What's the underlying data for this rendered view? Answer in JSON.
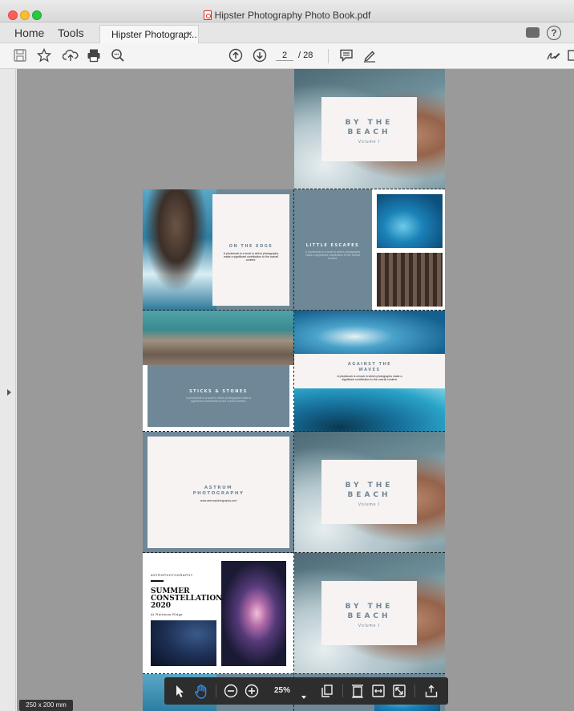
{
  "window": {
    "title": "Hipster Photography Photo Book.pdf"
  },
  "tabs": {
    "home": "Home",
    "tools": "Tools",
    "doc_tab": "Hipster Photograp...",
    "doc_close": "×"
  },
  "toolbar": {
    "current_page": "2",
    "total_pages": "/ 28"
  },
  "pages": {
    "beach": {
      "title_line1": "BY THE",
      "title_line2": "BEACH",
      "volume": "Volume I"
    },
    "edge": {
      "title": "ON THE EDGE",
      "body": "A photobook is a book in which photographs make a significant contribution to the overall content."
    },
    "escapes": {
      "title": "LITTLE ESCAPES",
      "body": "A photobook is a book in which photographs make a significant contribution to the overall content."
    },
    "sticks": {
      "title": "STICKS & STONES",
      "body": "A photobook is a book in which photographs make a significant contribution to the overall content."
    },
    "waves": {
      "title_line1": "AGAINST THE",
      "title_line2": "WAVES",
      "body": "A photobook is a book in which photographs make a significant contribution to the overall content."
    },
    "astrum": {
      "title_line1": "ASTRUM",
      "title_line2": "PHOTOGRAPHY",
      "url": "www.astrumphotography.com"
    },
    "summer": {
      "kicker": "ASTROPHOTOGRAPHY",
      "line1": "SUMMER",
      "line2": "CONSTELLATIONS",
      "line3": "2020",
      "sub": "At Rainbow Ridge"
    }
  },
  "status": {
    "dimensions": "250 x 200 mm"
  },
  "floating_toolbar": {
    "zoom": "25%"
  },
  "colors": {
    "accent_slate": "#6f8898",
    "canvas_bg": "#9a9a9a",
    "close_red": "#fc5f57",
    "min_yellow": "#fdbc2e",
    "max_green": "#28c840",
    "hand_tool_blue": "#2d8ceb"
  }
}
